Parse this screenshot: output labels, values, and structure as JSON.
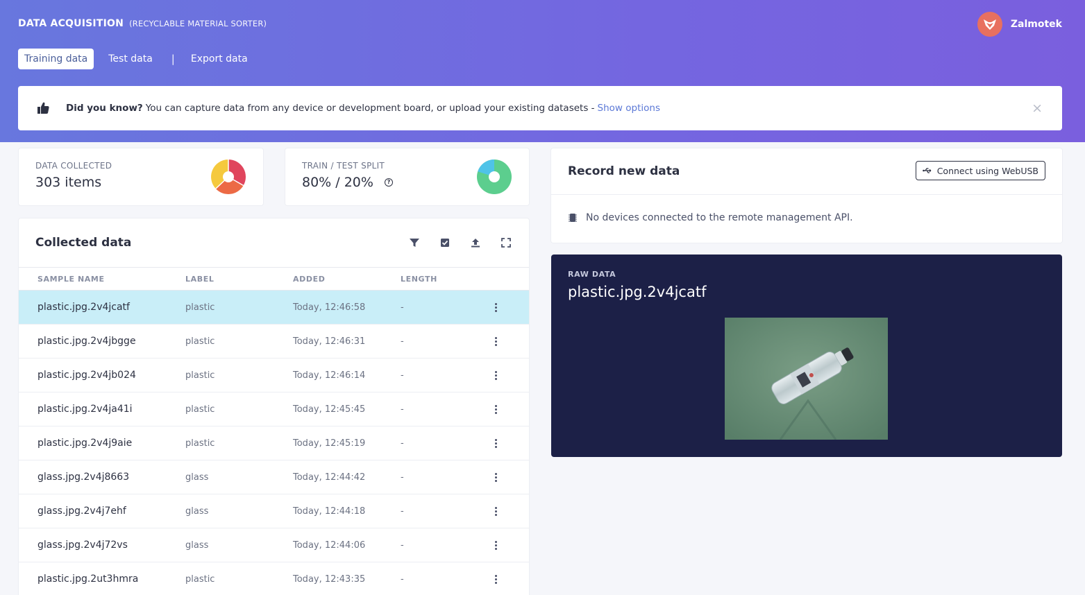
{
  "header": {
    "title": "DATA ACQUISITION",
    "subtitle": "(RECYCLABLE MATERIAL SORTER)",
    "user_name": "Zalmotek",
    "tabs": [
      {
        "label": "Training data",
        "active": true
      },
      {
        "label": "Test data",
        "active": false
      },
      {
        "label": "Export data",
        "active": false
      }
    ],
    "tab_separator": "|"
  },
  "tip": {
    "bold": "Did you know?",
    "text": "You can capture data from any device or development board, or upload your existing datasets -",
    "link": "Show options",
    "close": "×"
  },
  "stats": {
    "collected_label": "DATA COLLECTED",
    "collected_value": "303 items",
    "split_label": "TRAIN / TEST SPLIT",
    "split_value": "80% / 20%",
    "help_glyph": "?"
  },
  "collected": {
    "title": "Collected data",
    "columns": [
      "SAMPLE NAME",
      "LABEL",
      "ADDED",
      "LENGTH"
    ],
    "rows": [
      {
        "name": "plastic.jpg.2v4jcatf",
        "label": "plastic",
        "added": "Today, 12:46:58",
        "length": "-",
        "selected": true
      },
      {
        "name": "plastic.jpg.2v4jbgge",
        "label": "plastic",
        "added": "Today, 12:46:31",
        "length": "-"
      },
      {
        "name": "plastic.jpg.2v4jb024",
        "label": "plastic",
        "added": "Today, 12:46:14",
        "length": "-"
      },
      {
        "name": "plastic.jpg.2v4ja41i",
        "label": "plastic",
        "added": "Today, 12:45:45",
        "length": "-"
      },
      {
        "name": "plastic.jpg.2v4j9aie",
        "label": "plastic",
        "added": "Today, 12:45:19",
        "length": "-"
      },
      {
        "name": "glass.jpg.2v4j8663",
        "label": "glass",
        "added": "Today, 12:44:42",
        "length": "-"
      },
      {
        "name": "glass.jpg.2v4j7ehf",
        "label": "glass",
        "added": "Today, 12:44:18",
        "length": "-"
      },
      {
        "name": "glass.jpg.2v4j72vs",
        "label": "glass",
        "added": "Today, 12:44:06",
        "length": "-"
      },
      {
        "name": "plastic.jpg.2ut3hmra",
        "label": "plastic",
        "added": "Today, 12:43:35",
        "length": "-"
      }
    ]
  },
  "record": {
    "title": "Record new data",
    "button": "Connect using WebUSB",
    "message": "No devices connected to the remote management API."
  },
  "raw": {
    "label": "RAW DATA",
    "sample_name": "plastic.jpg.2v4jcatf"
  },
  "colors": {
    "header_gradient_start": "#6877de",
    "header_gradient_end": "#7a5fde",
    "selected_row": "#c9eef8",
    "raw_panel": "#1c2047",
    "link": "#5b78d6"
  }
}
